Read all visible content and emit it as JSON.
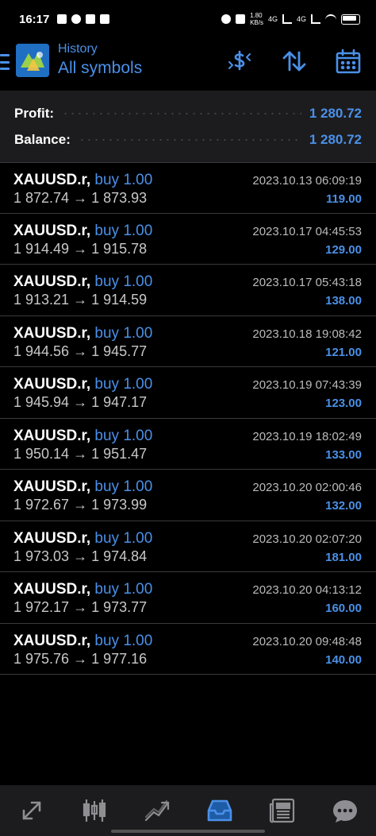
{
  "status_bar": {
    "time": "16:17",
    "net_speed": "1.80\nKB/s",
    "net1": "4G",
    "net2": "4G"
  },
  "header": {
    "subtitle": "History",
    "title": "All symbols",
    "icons": [
      "currency-dollar-icon",
      "sort-arrows-icon",
      "calendar-icon"
    ]
  },
  "summary": {
    "profit_label": "Profit:",
    "profit_value": "1 280.72",
    "balance_label": "Balance:",
    "balance_value": "1 280.72"
  },
  "trades": [
    {
      "symbol": "XAUUSD.r,",
      "side": "buy 1.00",
      "prices": "1 872.74 → 1 873.93",
      "time": "2023.10.13 06:09:19",
      "profit": "119.00"
    },
    {
      "symbol": "XAUUSD.r,",
      "side": "buy 1.00",
      "prices": "1 914.49 → 1 915.78",
      "time": "2023.10.17 04:45:53",
      "profit": "129.00"
    },
    {
      "symbol": "XAUUSD.r,",
      "side": "buy 1.00",
      "prices": "1 913.21 → 1 914.59",
      "time": "2023.10.17 05:43:18",
      "profit": "138.00"
    },
    {
      "symbol": "XAUUSD.r,",
      "side": "buy 1.00",
      "prices": "1 944.56 → 1 945.77",
      "time": "2023.10.18 19:08:42",
      "profit": "121.00"
    },
    {
      "symbol": "XAUUSD.r,",
      "side": "buy 1.00",
      "prices": "1 945.94 → 1 947.17",
      "time": "2023.10.19 07:43:39",
      "profit": "123.00"
    },
    {
      "symbol": "XAUUSD.r,",
      "side": "buy 1.00",
      "prices": "1 950.14 → 1 951.47",
      "time": "2023.10.19 18:02:49",
      "profit": "133.00"
    },
    {
      "symbol": "XAUUSD.r,",
      "side": "buy 1.00",
      "prices": "1 972.67 → 1 973.99",
      "time": "2023.10.20 02:00:46",
      "profit": "132.00"
    },
    {
      "symbol": "XAUUSD.r,",
      "side": "buy 1.00",
      "prices": "1 973.03 → 1 974.84",
      "time": "2023.10.20 02:07:20",
      "profit": "181.00"
    },
    {
      "symbol": "XAUUSD.r,",
      "side": "buy 1.00",
      "prices": "1 972.17 → 1 973.77",
      "time": "2023.10.20 04:13:12",
      "profit": "160.00"
    },
    {
      "symbol": "XAUUSD.r,",
      "side": "buy 1.00",
      "prices": "1 975.76 → 1 977.16",
      "time": "2023.10.20 09:48:48",
      "profit": "140.00"
    }
  ],
  "bottom_nav": {
    "items": [
      "quotes-icon",
      "chart-icon",
      "trade-icon",
      "history-icon",
      "news-icon",
      "messages-icon"
    ],
    "active": "history-icon"
  },
  "colors": {
    "accent": "#4a90e8",
    "background": "#000000",
    "panel": "#1c1c1e"
  }
}
